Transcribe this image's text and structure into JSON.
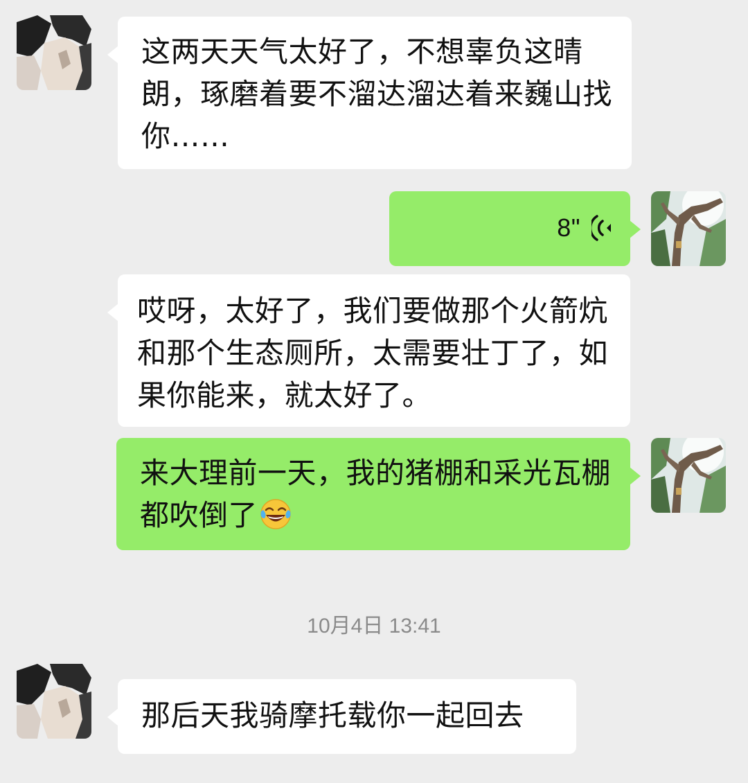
{
  "messages": [
    {
      "sender": "other",
      "avatar_icon": "blurred-avatar",
      "text": "这两天天气太好了，不想辜负这晴朗，琢磨着要不溜达溜达着来巍山找你……"
    },
    {
      "sender": "self",
      "avatar_icon": "tree-photo-avatar",
      "type": "voice",
      "duration": "8\"",
      "voice_icon": "voice-wave-icon"
    },
    {
      "sender": "other",
      "text": "哎呀，太好了，我们要做那个火箭炕和那个生态厕所，太需要壮丁了，如果你能来，就太好了。"
    },
    {
      "sender": "self",
      "avatar_icon": "tree-photo-avatar",
      "text": "来大理前一天，我的猪棚和采光瓦棚都吹倒了",
      "emoji_icon": "tears-of-joy-emoji"
    }
  ],
  "timestamp": "10月4日 13:41",
  "messages_after": [
    {
      "sender": "other",
      "avatar_icon": "blurred-avatar",
      "text": "那后天我骑摩托载你一起回去"
    }
  ],
  "colors": {
    "background": "#ededed",
    "incoming_bubble": "#ffffff",
    "outgoing_bubble": "#95ec69",
    "timestamp_text": "#8a8a8a"
  }
}
